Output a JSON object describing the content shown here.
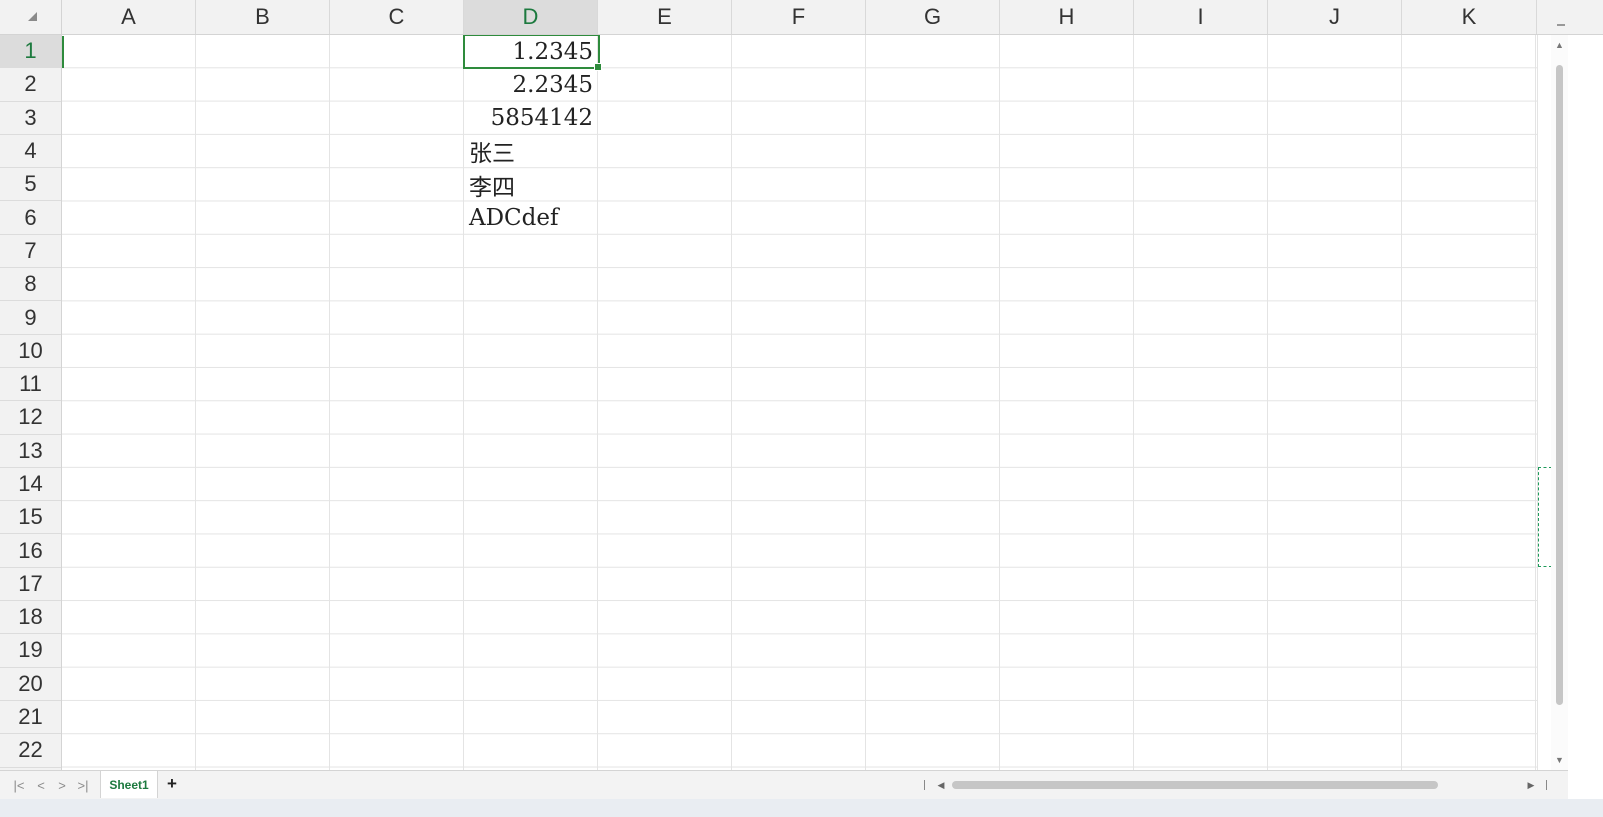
{
  "columns": [
    "A",
    "B",
    "C",
    "D",
    "E",
    "F",
    "G",
    "H",
    "I",
    "J",
    "K"
  ],
  "selected_column": "D",
  "rows": [
    "1",
    "2",
    "3",
    "4",
    "5",
    "6",
    "7",
    "8",
    "9",
    "10",
    "11",
    "12",
    "13",
    "14",
    "15",
    "16",
    "17",
    "18",
    "19",
    "20",
    "21",
    "22"
  ],
  "selected_row": "1",
  "cells": {
    "D1": "1.2345",
    "D2": "2.2345",
    "D3": "5854142",
    "D4": "张三",
    "D5": "李四",
    "D6": "ADCdef"
  },
  "active_cell": "D1",
  "sheet_tabs": [
    "Sheet1"
  ],
  "active_sheet": "Sheet1",
  "icons": {
    "first_sheet": "first-sheet-icon",
    "prev_sheet": "prev-sheet-icon",
    "next_sheet": "next-sheet-icon",
    "last_sheet": "last-sheet-icon",
    "add_sheet": "plus-icon",
    "select_all": "select-all-triangle-icon"
  },
  "accent_color": "#2e8b3c"
}
